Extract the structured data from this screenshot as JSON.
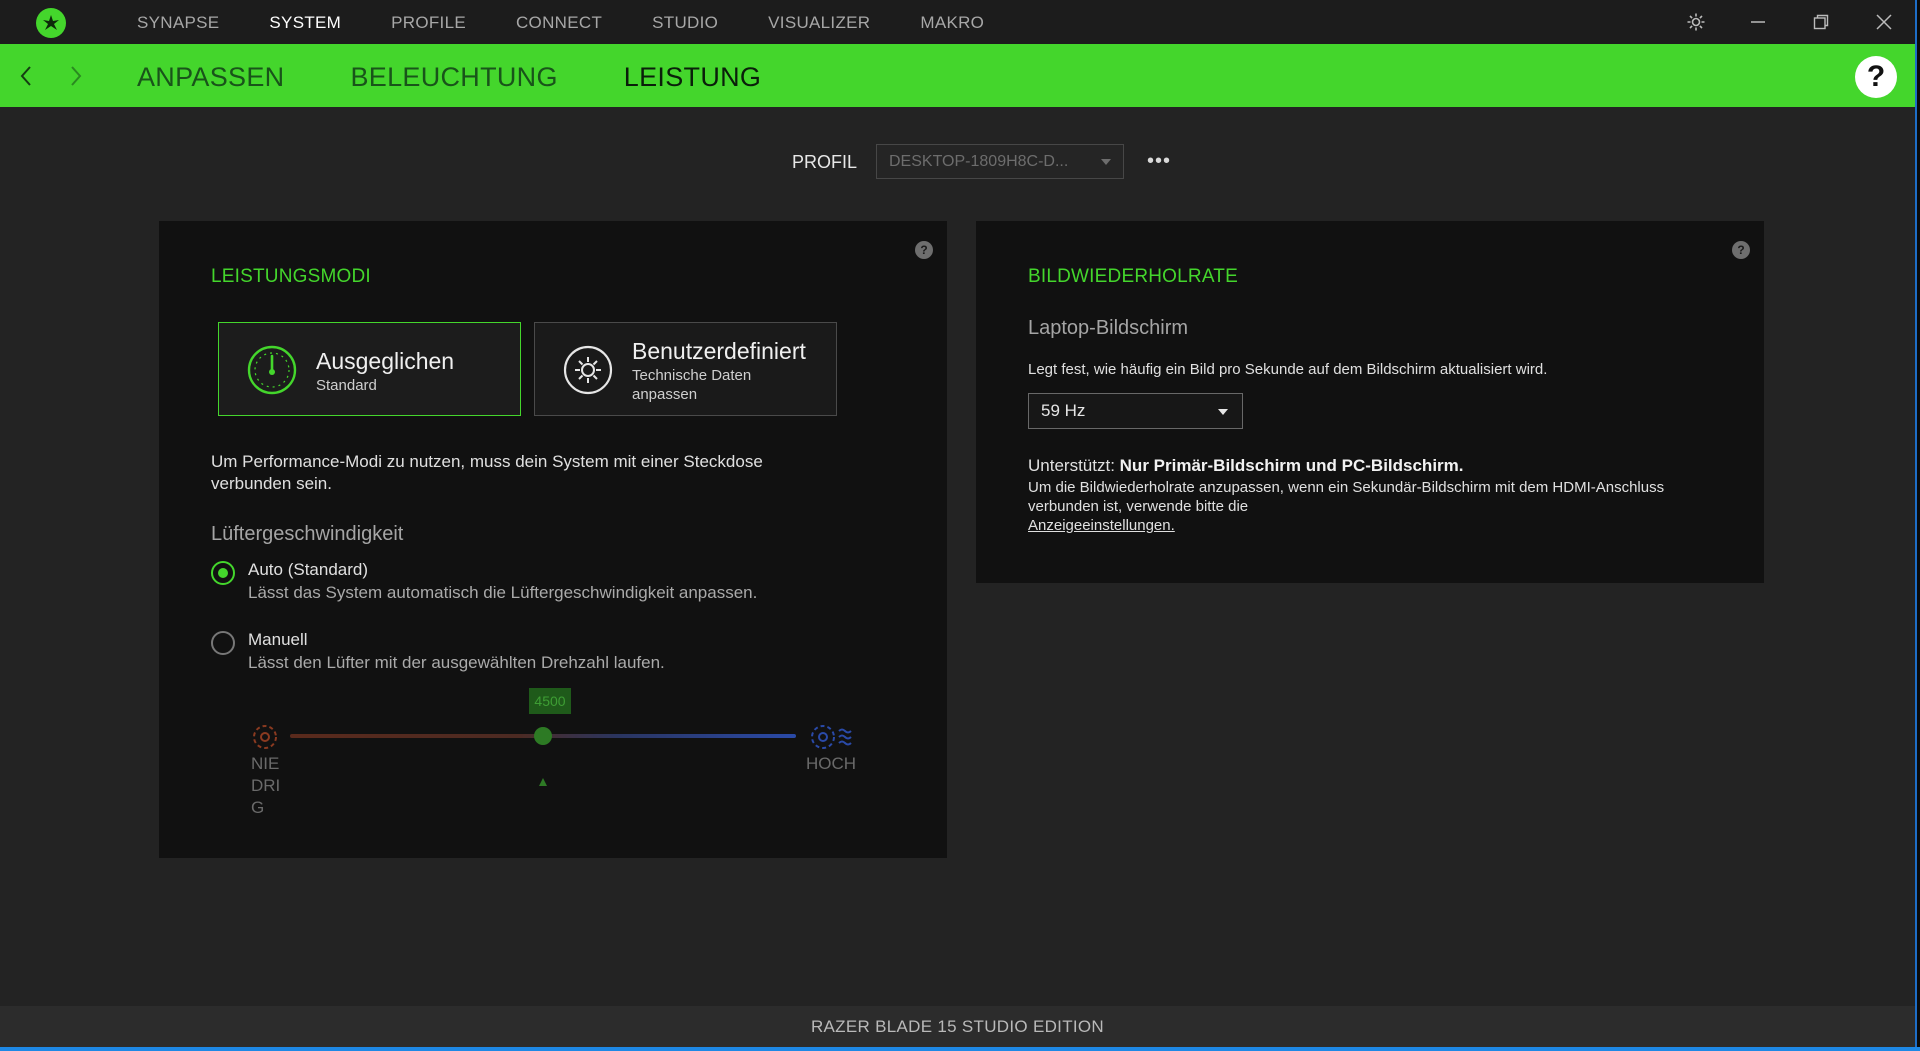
{
  "app": {
    "nav": [
      "SYNAPSE",
      "SYSTEM",
      "PROFILE",
      "CONNECT",
      "STUDIO",
      "VISUALIZER",
      "MAKRO"
    ],
    "nav_active": "SYSTEM",
    "subnav": [
      "ANPASSEN",
      "BELEUCHTUNG",
      "LEISTUNG"
    ],
    "subnav_active": "LEISTUNG",
    "help": "?"
  },
  "profile": {
    "label": "PROFIL",
    "value": "DESKTOP-1809H8C-D...",
    "more": "•••"
  },
  "performance": {
    "title": "LEISTUNGSMODI",
    "modes": [
      {
        "name": "Ausgeglichen",
        "sub": "Standard",
        "selected": true
      },
      {
        "name": "Benutzerdefiniert",
        "sub": "Technische Daten anpassen",
        "selected": false
      }
    ],
    "note": "Um Performance-Modi zu nutzen, muss dein System mit einer Steckdose verbunden sein.",
    "fan_title": "Lüftergeschwindigkeit",
    "fan_options": [
      {
        "label": "Auto (Standard)",
        "desc": "Lässt das System automatisch die Lüftergeschwindigkeit anpassen.",
        "selected": true
      },
      {
        "label": "Manuell",
        "desc": "Lässt den Lüfter mit der ausgewählten Drehzahl laufen.",
        "selected": false
      }
    ],
    "slider": {
      "value": "4500",
      "low_label": "NIEDRIG",
      "high_label": "HOCH"
    }
  },
  "refresh": {
    "title": "BILDWIEDERHOLRATE",
    "screen": "Laptop-Bildschirm",
    "desc": "Legt fest, wie häufig ein Bild pro Sekunde auf dem Bildschirm aktualisiert wird.",
    "value": "59 Hz",
    "supported_label": "Unterstützt:",
    "supported_value": "Nur Primär-Bildschirm und PC-Bildschirm.",
    "hint": "Um die Bildwiederholrate anzupassen, wenn ein Sekundär-Bildschirm mit dem HDMI-Anschluss verbunden ist, verwende bitte die",
    "hint_link": "Anzeigeeinstellungen."
  },
  "status": {
    "device": "RAZER BLADE 15 STUDIO EDITION"
  },
  "colors": {
    "accent": "#44d62c",
    "panel": "#111111",
    "background": "#232323"
  },
  "icons": [
    "razer-logo-icon",
    "settings-gear-icon",
    "minimize-icon",
    "restore-icon",
    "close-icon",
    "back-arrow-icon",
    "forward-arrow-icon",
    "help-icon",
    "speedometer-icon",
    "custom-gear-icon",
    "fan-low-icon",
    "fan-high-icon"
  ]
}
